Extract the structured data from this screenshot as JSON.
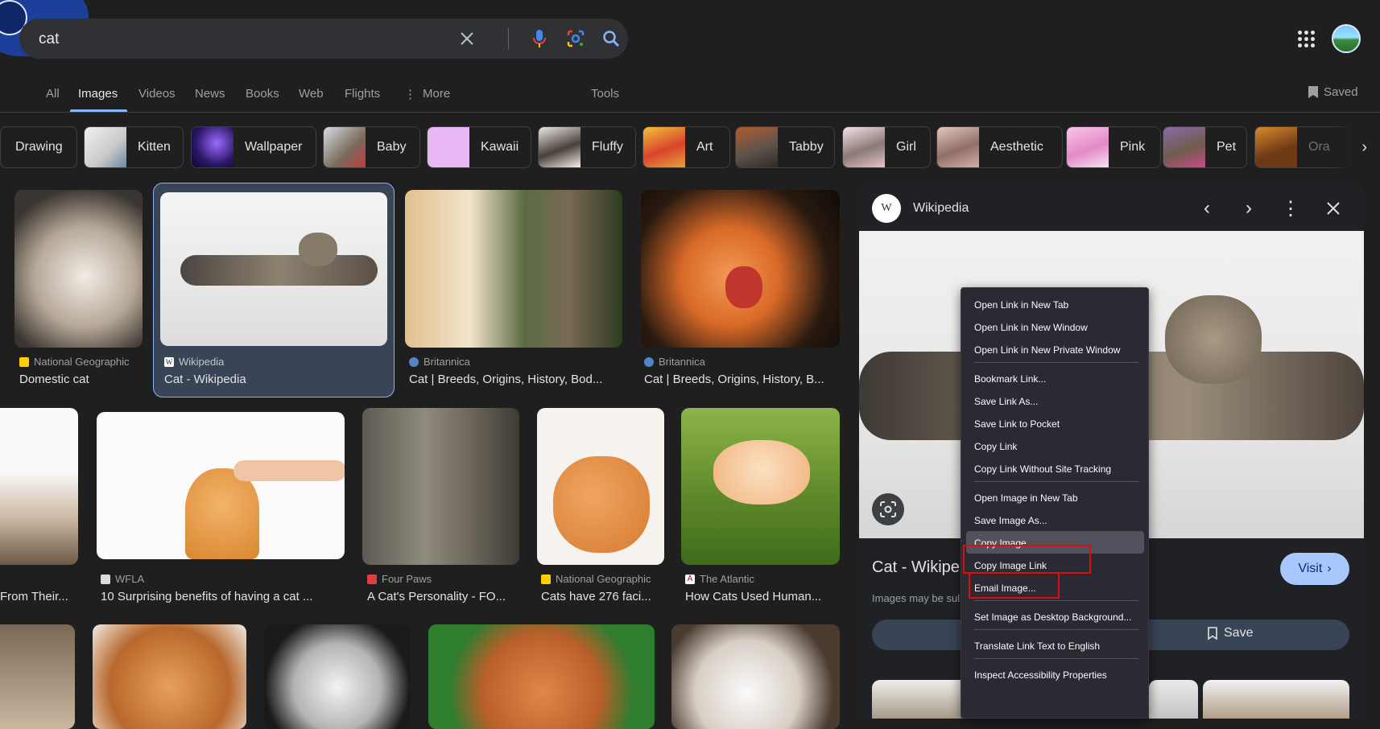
{
  "search": {
    "query": "cat"
  },
  "tabs": {
    "all": "All",
    "images": "Images",
    "videos": "Videos",
    "news": "News",
    "books": "Books",
    "web": "Web",
    "flights": "Flights",
    "more": "More",
    "tools": "Tools",
    "saved": "Saved"
  },
  "chips": [
    "Drawing",
    "Kitten",
    "Wallpaper",
    "Baby",
    "Kawaii",
    "Fluffy",
    "Art",
    "Tabby",
    "Girl",
    "Aesthetic",
    "Pink",
    "Pet",
    "Ora"
  ],
  "results": {
    "row1": [
      {
        "source": "National Geographic",
        "title": "Domestic cat"
      },
      {
        "source": "Wikipedia",
        "title": "Cat - Wikipedia"
      },
      {
        "source": "Britannica",
        "title": "Cat | Breeds, Origins, History, Bod..."
      },
      {
        "source": "Britannica",
        "title": "Cat | Breeds, Origins, History, B..."
      }
    ],
    "row2": [
      {
        "source": "",
        "title": "From Their..."
      },
      {
        "source": "WFLA",
        "title": "10 Surprising benefits of having a cat ..."
      },
      {
        "source": "Four Paws",
        "title": "A Cat's Personality - FO..."
      },
      {
        "source": "National Geographic",
        "title": "Cats have 276 faci..."
      },
      {
        "source": "The Atlantic",
        "title": "How Cats Used Human..."
      }
    ]
  },
  "panel": {
    "source": "Wikipedia",
    "source_icon_letter": "W",
    "title": "Cat - Wikipe",
    "note": "Images may be sul",
    "visit_label": "Visit",
    "save_label": "Save"
  },
  "context_menu": {
    "items": [
      "Open Link in New Tab",
      "Open Link in New Window",
      "Open Link in New Private Window",
      "Bookmark Link...",
      "Save Link As...",
      "Save Link to Pocket",
      "Copy Link",
      "Copy Link Without Site Tracking",
      "Open Image in New Tab",
      "Save Image As...",
      "Copy Image",
      "Copy Image Link",
      "Email Image...",
      "Set Image as Desktop Background...",
      "Translate Link Text to English",
      "Inspect Accessibility Properties"
    ],
    "highlighted": "Copy Image",
    "annotated": [
      "Copy Image",
      "Copy Image Link"
    ]
  },
  "colors": {
    "accent": "#8ab4f8",
    "visit_button": "#a8c7fa",
    "annotation_red": "#e00b0b",
    "menu_bg": "#2b2a33"
  }
}
